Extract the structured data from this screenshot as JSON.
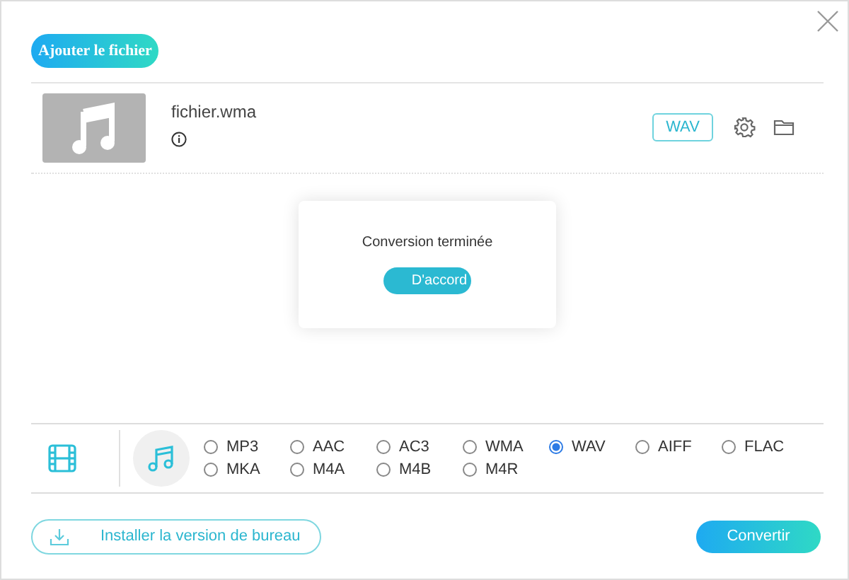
{
  "add_button": "Ajouter le fichier",
  "file": {
    "name": "fichier.wma",
    "format": "WAV"
  },
  "dialog": {
    "message": "Conversion terminée",
    "button": "D'accord"
  },
  "format_tabs": [
    {
      "kind": "video",
      "selected": false
    },
    {
      "kind": "audio",
      "selected": true
    }
  ],
  "formats": [
    {
      "label": "MP3",
      "selected": false
    },
    {
      "label": "AAC",
      "selected": false
    },
    {
      "label": "AC3",
      "selected": false
    },
    {
      "label": "WMA",
      "selected": false
    },
    {
      "label": "WAV",
      "selected": true
    },
    {
      "label": "AIFF",
      "selected": false
    },
    {
      "label": "FLAC",
      "selected": false
    },
    {
      "label": "MKA",
      "selected": false
    },
    {
      "label": "M4A",
      "selected": false
    },
    {
      "label": "M4B",
      "selected": false
    },
    {
      "label": "M4R",
      "selected": false
    }
  ],
  "install_button": "Installer la version de bureau",
  "convert_button": "Convertir"
}
